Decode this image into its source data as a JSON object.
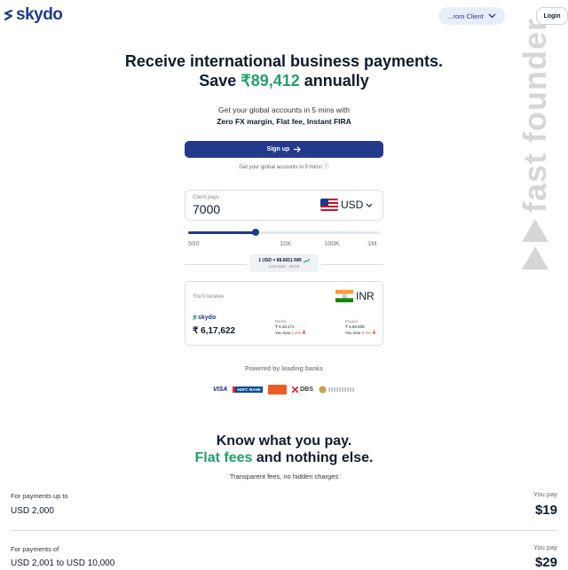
{
  "header": {
    "logo_text": "skydo",
    "client_selector": "...rom Client",
    "login_label": "Login"
  },
  "watermark": {
    "text": "fast founder"
  },
  "hero": {
    "title_line1": "Receive international business payments.",
    "title_save": "Save",
    "title_amount": "₹89,412",
    "title_annually": "annually",
    "sub_line1": "Get your global accounts in 5 mins with",
    "sub_line2": "Zero FX margin, Flat fee, Instant FIRA",
    "signup_label": "Sign up",
    "hint": "Get your global accounts in 5 mins! ⓘ"
  },
  "calculator": {
    "client_pays_label": "Client pays",
    "client_pays_value": "7000",
    "source_currency": "USD",
    "slider_value_fraction": 0.35,
    "slider_ticks": [
      "500",
      "10K",
      "100K",
      "1M"
    ],
    "rate_text": "1 USD = 88.6651 INR",
    "rate_sub": "Live Rate · 09:03",
    "receive_label": "You'll receive",
    "target_currency": "INR",
    "skydo_brand": "skydo",
    "skydo_amount": "₹ 6,17,622",
    "banks": {
      "label": "Banks",
      "amount": "₹ 6,10,171",
      "lose_label": "You lose",
      "lose_pct": "1.2%"
    },
    "paypal": {
      "label": "Paypal",
      "amount": "₹ 5,65,805",
      "lose_label": "You lose",
      "lose_pct": "8.7%"
    }
  },
  "partners": {
    "title": "Powered by leading banks",
    "logos": [
      "VISA",
      "HDFC BANK",
      "DBS"
    ]
  },
  "fees": {
    "title_line1": "Know what you pay.",
    "title_green": "Flat fees",
    "title_rest": "and nothing else.",
    "subtitle": "Transparent fees, no hidden charges",
    "rows": [
      {
        "label": "For payments up to",
        "range": "USD 2,000",
        "pay_label": "You pay",
        "pay_value": "$19"
      },
      {
        "label": "For payments of",
        "range": "USD 2,001 to USD 10,000",
        "pay_label": "You pay",
        "pay_value": "$29"
      }
    ]
  },
  "colors": {
    "brand": "#1d3b8c",
    "accent_green": "#22a06b",
    "loss_red": "#e0322a"
  }
}
